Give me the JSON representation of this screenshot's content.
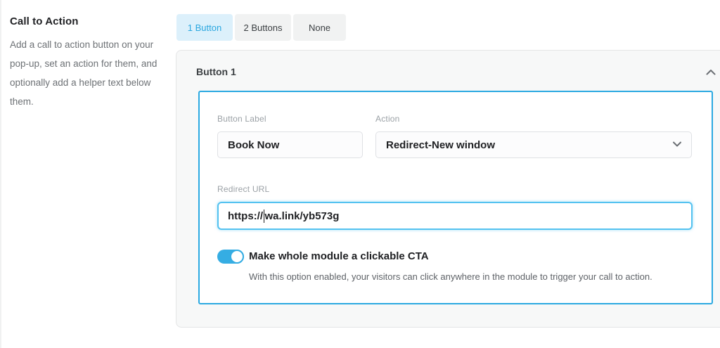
{
  "colors": {
    "accent": "#2BA9E1",
    "active_tab_bg": "#DCF0FB",
    "active_tab_text": "#2AA7E0",
    "focus_border": "#54C2F0",
    "toggle_on": "#35ADE3"
  },
  "sidebar": {
    "title": "Call to Action",
    "description": "Add a call to action button on your pop-up, set an action for them, and optionally add a helper text below them.",
    "description_lines": [
      "Add a call to action button on your",
      "pop-up, set an action for them, and",
      "optionally add a helper text below",
      "them."
    ]
  },
  "tabs": [
    {
      "label": "1 Button",
      "active": true
    },
    {
      "label": "2 Buttons",
      "active": false
    },
    {
      "label": "None",
      "active": false
    }
  ],
  "panel": {
    "title": "Button 1",
    "collapse_icon": "chevron-up-icon",
    "fields": {
      "button_label": {
        "label": "Button Label",
        "value": "Book Now"
      },
      "action": {
        "label": "Action",
        "value": "Redirect-New window"
      },
      "redirect_url": {
        "label": "Redirect URL",
        "value": "https://wa.link/yb573g",
        "value_before_caret": "https://",
        "value_after_caret": "wa.link/yb573g"
      }
    },
    "toggle": {
      "label": "Make whole module a clickable CTA",
      "state": "on",
      "helper": "With this option enabled, your visitors can click anywhere in the module to trigger your call to action."
    }
  }
}
